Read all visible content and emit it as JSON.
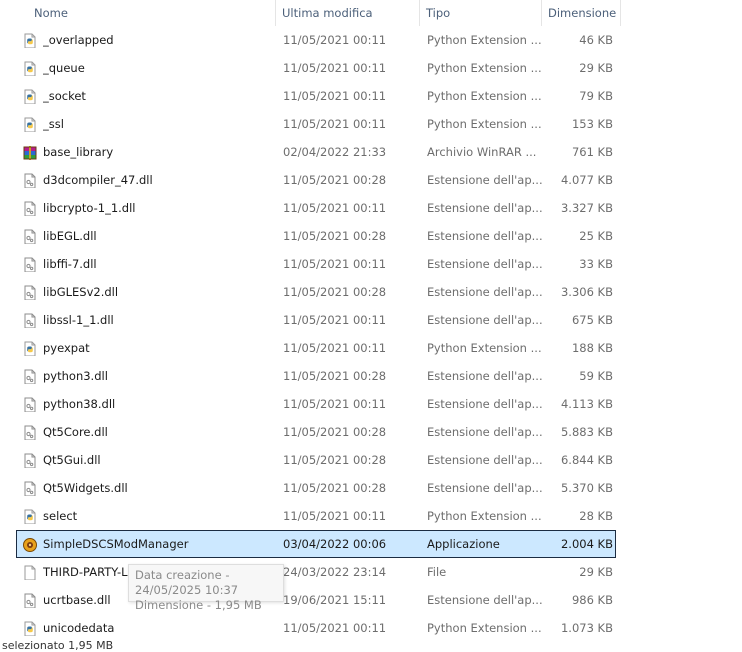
{
  "columns": {
    "name": "Nome",
    "date": "Ultima modifica",
    "type": "Tipo",
    "size": "Dimensione"
  },
  "files": [
    {
      "name": "_overlapped",
      "date": "11/05/2021 00:11",
      "type": "Python Extension ...",
      "size": "46 KB",
      "icon": "python-file-icon"
    },
    {
      "name": "_queue",
      "date": "11/05/2021 00:11",
      "type": "Python Extension ...",
      "size": "29 KB",
      "icon": "python-file-icon"
    },
    {
      "name": "_socket",
      "date": "11/05/2021 00:11",
      "type": "Python Extension ...",
      "size": "79 KB",
      "icon": "python-file-icon"
    },
    {
      "name": "_ssl",
      "date": "11/05/2021 00:11",
      "type": "Python Extension ...",
      "size": "153 KB",
      "icon": "python-file-icon"
    },
    {
      "name": "base_library",
      "date": "02/04/2022 21:33",
      "type": "Archivio WinRAR ...",
      "size": "761 KB",
      "icon": "winrar-archive-icon"
    },
    {
      "name": "d3dcompiler_47.dll",
      "date": "11/05/2021 00:28",
      "type": "Estensione dell'ap...",
      "size": "4.077 KB",
      "icon": "dll-file-icon"
    },
    {
      "name": "libcrypto-1_1.dll",
      "date": "11/05/2021 00:11",
      "type": "Estensione dell'ap...",
      "size": "3.327 KB",
      "icon": "dll-file-icon"
    },
    {
      "name": "libEGL.dll",
      "date": "11/05/2021 00:28",
      "type": "Estensione dell'ap...",
      "size": "25 KB",
      "icon": "dll-file-icon"
    },
    {
      "name": "libffi-7.dll",
      "date": "11/05/2021 00:11",
      "type": "Estensione dell'ap...",
      "size": "33 KB",
      "icon": "dll-file-icon"
    },
    {
      "name": "libGLESv2.dll",
      "date": "11/05/2021 00:28",
      "type": "Estensione dell'ap...",
      "size": "3.306 KB",
      "icon": "dll-file-icon"
    },
    {
      "name": "libssl-1_1.dll",
      "date": "11/05/2021 00:11",
      "type": "Estensione dell'ap...",
      "size": "675 KB",
      "icon": "dll-file-icon"
    },
    {
      "name": "pyexpat",
      "date": "11/05/2021 00:11",
      "type": "Python Extension ...",
      "size": "188 KB",
      "icon": "python-file-icon"
    },
    {
      "name": "python3.dll",
      "date": "11/05/2021 00:28",
      "type": "Estensione dell'ap...",
      "size": "59 KB",
      "icon": "dll-file-icon"
    },
    {
      "name": "python38.dll",
      "date": "11/05/2021 00:11",
      "type": "Estensione dell'ap...",
      "size": "4.113 KB",
      "icon": "dll-file-icon"
    },
    {
      "name": "Qt5Core.dll",
      "date": "11/05/2021 00:28",
      "type": "Estensione dell'ap...",
      "size": "5.883 KB",
      "icon": "dll-file-icon"
    },
    {
      "name": "Qt5Gui.dll",
      "date": "11/05/2021 00:28",
      "type": "Estensione dell'ap...",
      "size": "6.844 KB",
      "icon": "dll-file-icon"
    },
    {
      "name": "Qt5Widgets.dll",
      "date": "11/05/2021 00:28",
      "type": "Estensione dell'ap...",
      "size": "5.370 KB",
      "icon": "dll-file-icon"
    },
    {
      "name": "select",
      "date": "11/05/2021 00:11",
      "type": "Python Extension ...",
      "size": "28 KB",
      "icon": "python-file-icon"
    },
    {
      "name": "SimpleDSCSModManager",
      "date": "03/04/2022 00:06",
      "type": "Applicazione",
      "size": "2.004 KB",
      "icon": "application-icon",
      "selected": true
    },
    {
      "name": "THIRD-PARTY-LICENSES",
      "date": "24/03/2022 23:14",
      "type": "File",
      "size": "29 KB",
      "icon": "generic-file-icon"
    },
    {
      "name": "ucrtbase.dll",
      "date": "19/06/2021 15:11",
      "type": "Estensione dell'ap...",
      "size": "986 KB",
      "icon": "dll-file-icon"
    },
    {
      "name": "unicodedata",
      "date": "11/05/2021 00:11",
      "type": "Python Extension ...",
      "size": "1.073 KB",
      "icon": "python-file-icon"
    }
  ],
  "tooltip": {
    "line1": "Data creazione - 24/05/2025 10:37",
    "line2": "Dimensione - 1,95 MB"
  },
  "status": {
    "text": "selezionato 1,95 MB"
  },
  "colors": {
    "selection_bg": "#cce8ff",
    "selection_border": "#1b2c42",
    "header_text": "#4c607a",
    "detail_text": "#6d6d6d"
  }
}
